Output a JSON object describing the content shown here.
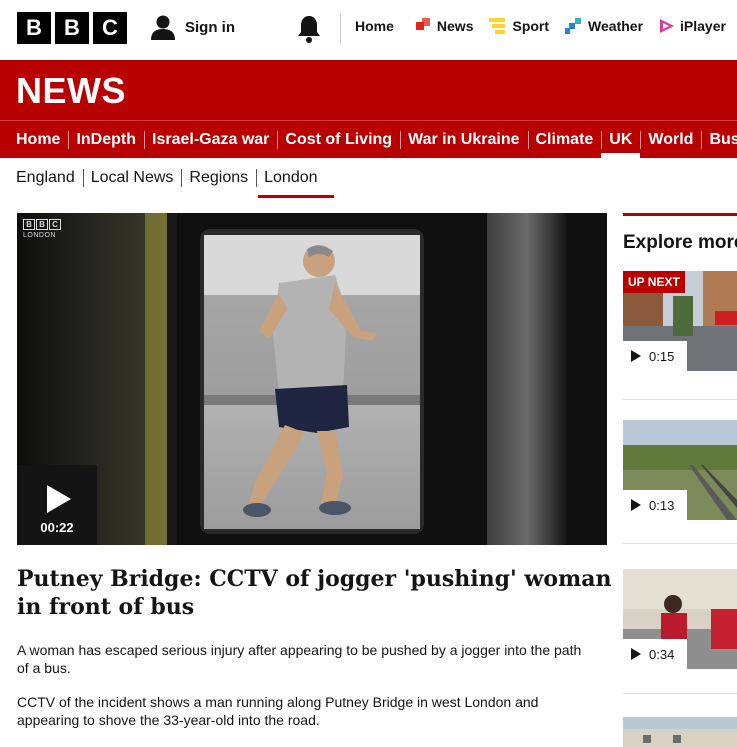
{
  "masthead": {
    "logo_letters": [
      "B",
      "B",
      "C"
    ],
    "sign_in": "Sign in",
    "nav": [
      {
        "label": "Home",
        "icon": "none"
      },
      {
        "label": "News",
        "icon": "news-icon",
        "color": "#e2231a"
      },
      {
        "label": "Sport",
        "icon": "sport-icon",
        "color": "#ffd230"
      },
      {
        "label": "Weather",
        "icon": "weather-icon",
        "color": "#1e88c8"
      },
      {
        "label": "iPlayer",
        "icon": "iplayer-icon",
        "color": "#e0399e"
      }
    ]
  },
  "banner": {
    "title": "NEWS"
  },
  "section_nav": [
    {
      "label": "Home",
      "active": false
    },
    {
      "label": "InDepth",
      "active": false
    },
    {
      "label": "Israel-Gaza war",
      "active": false
    },
    {
      "label": "Cost of Living",
      "active": false
    },
    {
      "label": "War in Ukraine",
      "active": false
    },
    {
      "label": "Climate",
      "active": false
    },
    {
      "label": "UK",
      "active": true
    },
    {
      "label": "World",
      "active": false
    },
    {
      "label": "Business",
      "active": false
    }
  ],
  "sub_nav": [
    {
      "label": "England",
      "active": false
    },
    {
      "label": "Local News",
      "active": false
    },
    {
      "label": "Regions",
      "active": false
    },
    {
      "label": "London",
      "active": true
    }
  ],
  "hero": {
    "logo_letters": [
      "B",
      "B",
      "C"
    ],
    "logo_sub": "LONDON",
    "duration": "00:22"
  },
  "article": {
    "headline": "Putney Bridge: CCTV of jogger 'pushing' woman in front of bus",
    "paragraphs": [
      "A woman has escaped serious injury after appearing to be pushed by a jogger into the path of a bus.",
      "CCTV of the incident shows a man running along Putney Bridge in west London and appearing to shove the 33-year-old into the road."
    ]
  },
  "sidebar": {
    "title": "Explore more",
    "up_next_label": "UP NEXT",
    "items": [
      {
        "duration": "0:15",
        "up_next": true
      },
      {
        "duration": "0:13",
        "up_next": false
      },
      {
        "duration": "0:34",
        "up_next": false
      }
    ]
  },
  "colors": {
    "brand_red": "#b80000",
    "dark": "#141414"
  }
}
